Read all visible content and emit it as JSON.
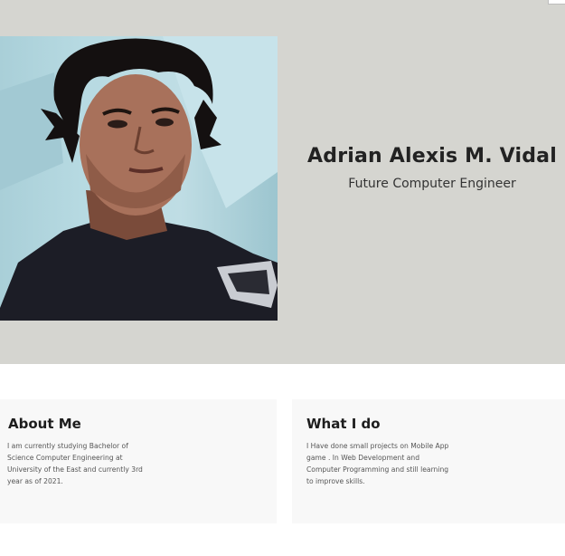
{
  "profile": {
    "name": "Adrian Alexis M. Vidal",
    "role": "Future Computer Engineer",
    "photo_icon": "profile-photo"
  },
  "about": {
    "title": "About Me",
    "body": "I am currently studying Bachelor of Science Computer Engineering at University of the East and currently 3rd year as of 2021."
  },
  "what": {
    "title": "What I do",
    "body": "I Have done small projects on Mobile App game . In Web Development and Computer Programming and still learning to improve skills."
  },
  "colors": {
    "hero_background": "#d5d5d0",
    "card_background": "#f8f8f8",
    "photo_background": "#b7dae2"
  }
}
